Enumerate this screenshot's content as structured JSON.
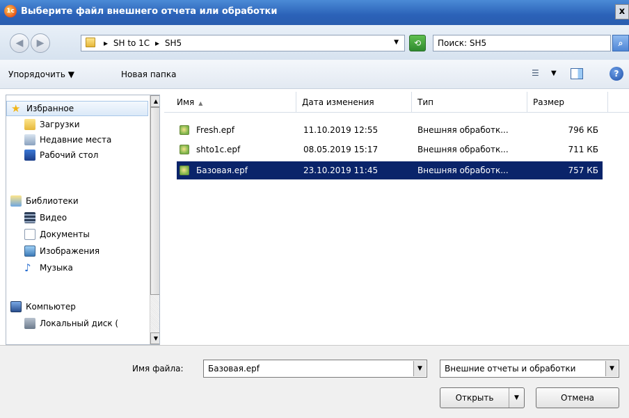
{
  "window": {
    "title": "Выберите файл внешнего отчета или обработки",
    "app_icon": "1с",
    "close_label": "x"
  },
  "address": {
    "crumbs": [
      "SH to 1C",
      "SH5"
    ],
    "crumb_sep": "▸",
    "search_placeholder": "Поиск: SH5"
  },
  "toolbar": {
    "organize_label": "Упорядочить ▼",
    "new_folder_label": "Новая папка"
  },
  "sidebar": {
    "favorites": {
      "label": "Избранное",
      "items": [
        "Загрузки",
        "Недавние места",
        "Рабочий стол"
      ]
    },
    "libraries": {
      "label": "Библиотеки",
      "items": [
        "Видео",
        "Документы",
        "Изображения",
        "Музыка"
      ]
    },
    "computer": {
      "label": "Компьютер",
      "items": [
        "Локальный диск ("
      ]
    }
  },
  "file_list": {
    "columns": [
      "Имя",
      "Дата изменения",
      "Тип",
      "Размер"
    ],
    "rows": [
      {
        "name": "Fresh.epf",
        "date": "11.10.2019 12:55",
        "type": "Внешняя обработк...",
        "size": "796 КБ",
        "selected": false
      },
      {
        "name": "shto1c.epf",
        "date": "08.05.2019 15:17",
        "type": "Внешняя обработк...",
        "size": "711 КБ",
        "selected": false
      },
      {
        "name": "Базовая.epf",
        "date": "23.10.2019 11:45",
        "type": "Внешняя обработк...",
        "size": "757 КБ",
        "selected": true
      }
    ]
  },
  "footer": {
    "filename_label": "Имя файла:",
    "filename_value": "Базовая.epf",
    "filetype_value": "Внешние отчеты и обработки",
    "open_label": "Открыть",
    "cancel_label": "Отмена"
  },
  "colors": {
    "selection": "#0a246a",
    "titlebar": "#2b62b8"
  }
}
